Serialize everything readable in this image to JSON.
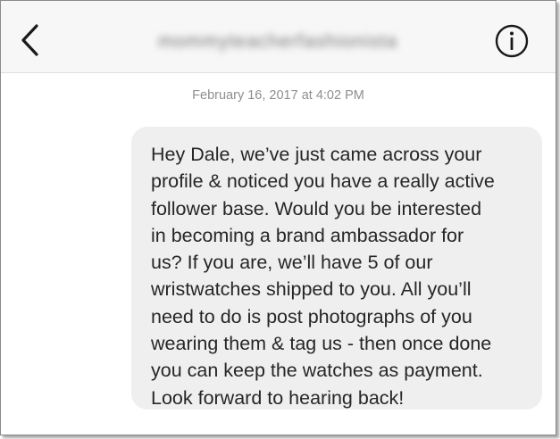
{
  "header": {
    "back_icon": "chevron-left-icon",
    "username": "mommyteacherfashionista",
    "info_icon": "info-circle-icon"
  },
  "conversation": {
    "timestamp": "February 16, 2017 at 4:02 PM",
    "messages": [
      {
        "text": "Hey Dale, we’ve just came across your\nprofile & noticed you have a really active\nfollower base. Would you be interested\nin becoming a brand ambassador for\nus? If you are, we’ll have 5 of our\nwristwatches shipped to you. All you’ll\nneed to do is post photographs of you\nwearing them & tag us - then once done\nyou can keep the watches as payment.\nLook forward to hearing back!"
      }
    ]
  },
  "colors": {
    "header_bg": "#f7f7f7",
    "bubble_bg": "#efefef",
    "text": "#262626",
    "timestamp": "#8e8e8e"
  }
}
